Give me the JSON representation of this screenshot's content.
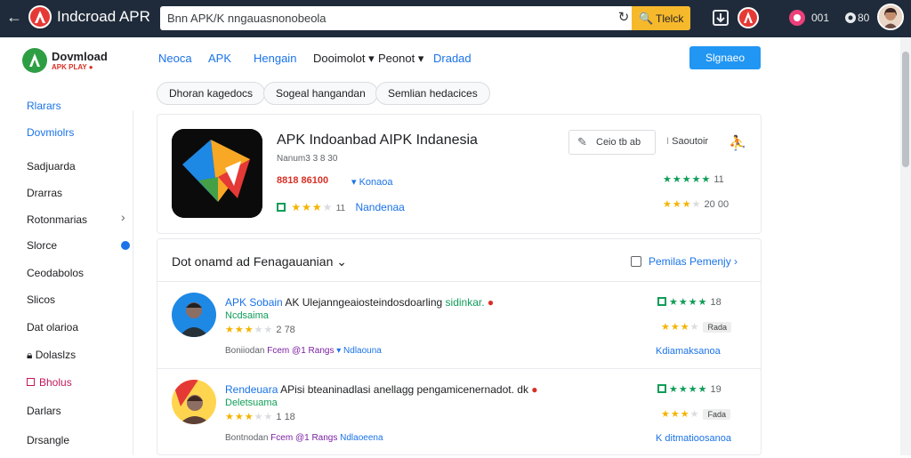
{
  "topbar": {
    "title": "Indcroad APR",
    "search_value": "Bnn APK/K nngauasnonobeola",
    "search_button": "Tlelck",
    "counter1": "001",
    "counter2": "80"
  },
  "nav": {
    "brand": "Dovmload",
    "brand_sub": "APK PLAY ●",
    "items": [
      "Neoca",
      "APK",
      "Hengain",
      "Dooimolot ▾",
      "Peonot ▾",
      "Dradad"
    ],
    "signin": "Slgnaeo"
  },
  "chips": [
    "Dhoran kagedocs",
    "Sogeal hangandan",
    "Semlian hedacices"
  ],
  "sidebar": {
    "items": [
      "Rlarars",
      "Dovmiolrs",
      "Sadjuarda",
      "Drarras",
      "Rotonmarias",
      "Slorce",
      "Ceodabolos",
      "Slicos",
      "Dat olarioa",
      "Dolaslzs",
      "Bholus",
      "Darlars",
      "Drsangle"
    ]
  },
  "app": {
    "name": "APK Indoanbad AIPK Indanesia",
    "sub": "Nanum3 3 8 30",
    "price": "8818 86100",
    "price_link": "▾ Konaoa",
    "rating_label": "11",
    "rating_link": "Nandenaa",
    "install_label": "Ceio tb ab",
    "share_label": "Saoutoir",
    "right_rating1": "11",
    "right_rating2": "20 00"
  },
  "reviews": {
    "heading": "Dot onamd ad Fenagauanian",
    "filter_label": "Pemilas Pemenjy",
    "items": [
      {
        "name": "APK Sobain",
        "title": "AK Ulejanngeaiosteindosdoarling",
        "title_green": "sidinkar.",
        "sub": "Ncdsaima",
        "stars_count": "2 78",
        "meta_prefix": "Boniiodan",
        "meta_purple": "Fcem @1 Rangs",
        "meta_link": "▾ Ndlaouna",
        "right_rating": "18",
        "right_tag": "Rada",
        "right_link": "Kdiamaksanoa"
      },
      {
        "name": "Rendeuara",
        "title": "APisi bteaninadlasi anellagg pengamicenernadot.",
        "title_green": "dk",
        "sub": "Deletsuama",
        "stars_count": "1 18",
        "meta_prefix": "Bontnodan",
        "meta_purple": "Fcem @1 Rangs",
        "meta_link": "Ndlaoeena",
        "right_rating": "19",
        "right_tag": "Fada",
        "right_link": "K ditmatioosanoa"
      }
    ]
  }
}
